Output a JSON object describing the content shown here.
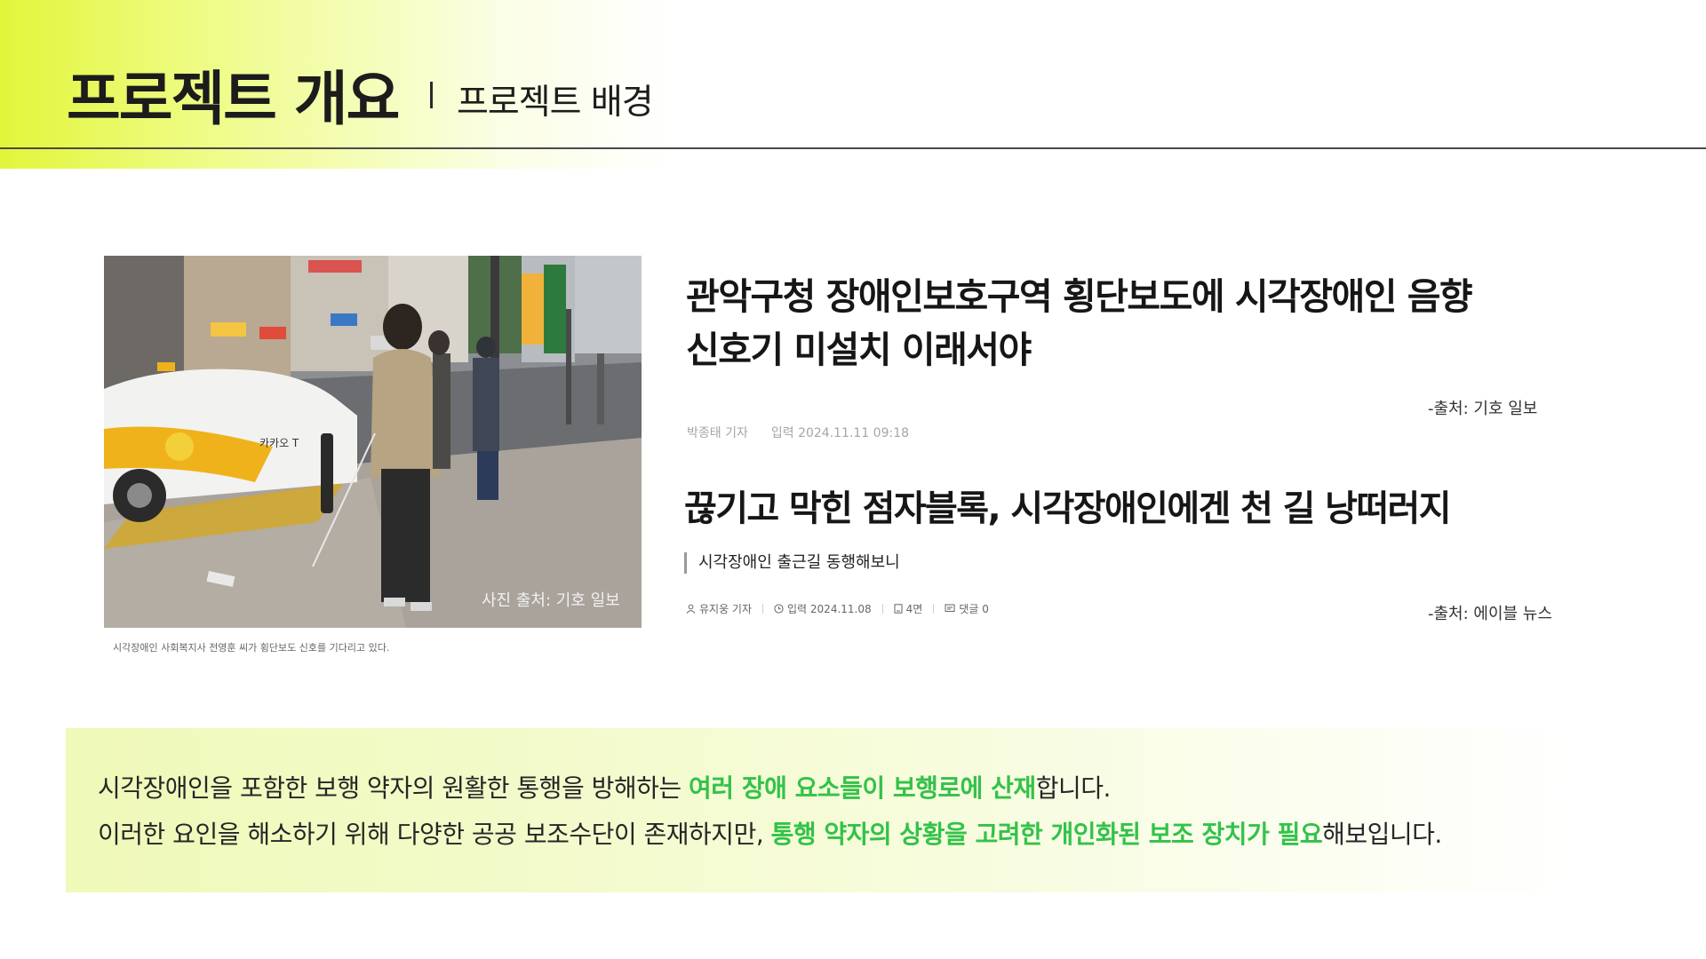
{
  "header": {
    "title": "프로젝트 개요",
    "subtitle": "프로젝트 배경"
  },
  "photo": {
    "store_sign": "카카오 T",
    "watermark": "사진 출처: 기호 일보",
    "caption": "시각장애인 사회복지사 전영훈 씨가 횡단보도 신호를 기다리고 있다."
  },
  "article1": {
    "title_line1": "관악구청 장애인보호구역 횡단보도에 시각장애인 음향",
    "title_line2": "신호기 미설치 이래서야",
    "source": "-출처: 기호 일보",
    "reporter": "박종태 기자",
    "date": "입력 2024.11.11 09:18"
  },
  "article2": {
    "title": "끊기고 막힌 점자블록, 시각장애인에겐 천 길 낭떠러지",
    "subtitle": "시각장애인 출근길 동행해보니",
    "reporter": "유지웅 기자",
    "date": "입력 2024.11.08",
    "page": "4면",
    "comments": "댓글 0",
    "source": "-출처: 에이블 뉴스"
  },
  "summary": {
    "line1_prefix": "시각장애인을 포함한 보행 약자의 원활한 통행을 방해하는 ",
    "line1_highlight": "여러 장애 요소들이 보행로에 산재",
    "line1_suffix": "합니다.",
    "line2_prefix": "이러한 요인을 해소하기 위해 다양한 공공 보조수단이 존재하지만, ",
    "line2_highlight": "통행 약자의 상황을 고려한 개인화된 보조 장치가 필요",
    "line2_suffix": "해보입니다."
  },
  "colors": {
    "accent_green": "#33c24a",
    "header_yellow": "#e2f53a"
  }
}
